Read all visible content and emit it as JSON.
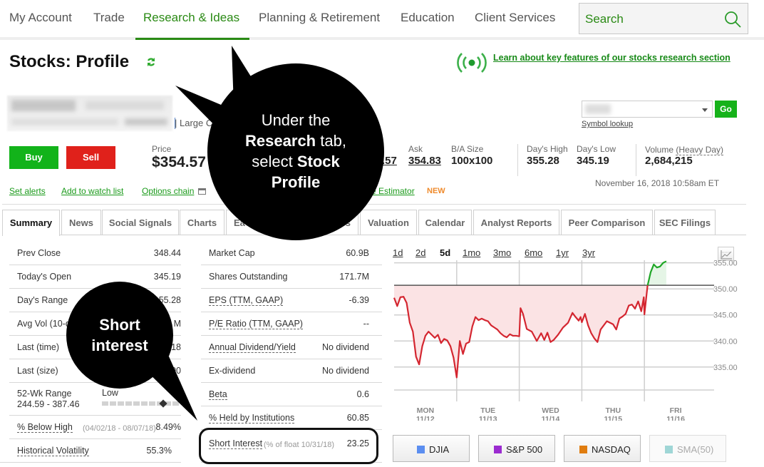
{
  "nav": {
    "items": [
      "My Account",
      "Trade",
      "Research & Ideas",
      "Planning & Retirement",
      "Education",
      "Client Services"
    ],
    "active_index": 2,
    "search_placeholder": "Search",
    "accent_color": "#2a8a14"
  },
  "header": {
    "title": "Stocks: Profile",
    "learn_link": "Learn about key features of our stocks research section"
  },
  "company": {
    "cap_label": "| Large Ca",
    "symbol_lookup": "Symbol lookup",
    "go_label": "Go"
  },
  "quote": {
    "buy_label": "Buy",
    "sell_label": "Sell",
    "price_label": "Price",
    "price": "$354.57",
    "bid_partial": ".57",
    "ask_label": "Ask",
    "ask": "354.83",
    "ba_size_label": "B/A Size",
    "ba_size": "100x100",
    "days_high_label": "Day's High",
    "days_high": "355.28",
    "days_low_label": "Day's Low",
    "days_low": "345.19",
    "volume_label": "Volume",
    "heavy_day_label": "(Heavy Day)",
    "volume": "2,684,215",
    "timestamp": "November 16, 2018 10:58am ET"
  },
  "actions": {
    "set_alerts": "Set alerts",
    "add_watch": "Add to watch list",
    "options_chain": "Options chain",
    "estimator_partial": "e Estimator",
    "new_badge": "NEW"
  },
  "tabs": [
    "Summary",
    "News",
    "Social Signals",
    "Charts",
    "Ea",
    "s",
    "Valuation",
    "Calendar",
    "Analyst Reports",
    "Peer Comparison",
    "SEC Filings"
  ],
  "summary_left": [
    {
      "key": "Prev Close",
      "value": "348.44"
    },
    {
      "key": "Today's Open",
      "value": "345.19"
    },
    {
      "key": "Day's Range",
      "value": "55.28"
    },
    {
      "key": "Avg Vol (10-d",
      "value": "M"
    },
    {
      "key": "Last (time)",
      "value": "18"
    },
    {
      "key": "Last (size)",
      "value": "00"
    },
    {
      "key": "52-Wk Range",
      "key2": "244.59 - 387.46",
      "range_low_label": "Low",
      "range_position": 0.78
    },
    {
      "key": "% Below High",
      "sub": "(04/02/18 - 08/07/18)",
      "value": "8.49%"
    },
    {
      "key": "Historical Volatility",
      "value": "55.3%"
    }
  ],
  "summary_right": [
    {
      "key": "Market Cap",
      "value": "60.9B"
    },
    {
      "key": "Shares Outstanding",
      "value": "171.7M"
    },
    {
      "key": "EPS (TTM, GAAP)",
      "value": "-6.39"
    },
    {
      "key": "P/E Ratio (TTM, GAAP)",
      "value": "--"
    },
    {
      "key": "Annual Dividend/Yield",
      "value": "No dividend"
    },
    {
      "key": "Ex-dividend",
      "value": "No dividend"
    },
    {
      "key": "Beta",
      "value": "0.6"
    },
    {
      "key": "% Held by Institutions",
      "value": "60.85"
    },
    {
      "key": "Short Interest",
      "sub": "(% of float 10/31/18)",
      "value": "23.25"
    }
  ],
  "chart": {
    "ranges": [
      "1d",
      "2d",
      "5d",
      "1mo",
      "3mo",
      "6mo",
      "1yr",
      "3yr"
    ],
    "active_range": "5d",
    "compare_buttons": [
      {
        "label": "DJIA",
        "color": "#5b8ef0",
        "enabled": true
      },
      {
        "label": "S&P 500",
        "color": "#9b2bd0",
        "enabled": true
      },
      {
        "label": "NASDAQ",
        "color": "#e07d10",
        "enabled": true
      },
      {
        "label": "SMA(50)",
        "color": "#9fd6d6",
        "enabled": false
      }
    ]
  },
  "chart_data": {
    "type": "line",
    "title": "",
    "xlabel": "",
    "ylabel": "",
    "x_tick_labels": [
      {
        "day": "MON",
        "date": "11/12"
      },
      {
        "day": "TUE",
        "date": "11/13"
      },
      {
        "day": "WED",
        "date": "11/14"
      },
      {
        "day": "THU",
        "date": "11/15"
      },
      {
        "day": "FRI",
        "date": "11/16"
      }
    ],
    "y_tick_labels": [
      "355.00",
      "350.00",
      "345.00",
      "340.00",
      "335.00"
    ],
    "ylim": [
      329.5,
      355.5
    ],
    "xlim": [
      0,
      5
    ],
    "reference_line": 350.7,
    "grid": true,
    "series": [
      {
        "name": "price",
        "below_color": "#d42630",
        "above_color": "#1fa626",
        "x": [
          0,
          0.05,
          0.1,
          0.15,
          0.2,
          0.25,
          0.3,
          0.35,
          0.4,
          0.45,
          0.5,
          0.55,
          0.6,
          0.65,
          0.7,
          0.75,
          0.8,
          0.85,
          0.9,
          0.95,
          1.0,
          1.05,
          1.1,
          1.15,
          1.2,
          1.25,
          1.3,
          1.35,
          1.4,
          1.45,
          1.5,
          1.55,
          1.6,
          1.65,
          1.7,
          1.75,
          1.8,
          1.85,
          1.9,
          1.95,
          2.0,
          2.02,
          2.06,
          2.12,
          2.2,
          2.28,
          2.35,
          2.4,
          2.45,
          2.5,
          2.55,
          2.62,
          2.7,
          2.78,
          2.85,
          2.9,
          2.95,
          2.98,
          3.0,
          3.05,
          3.1,
          3.15,
          3.2,
          3.25,
          3.3,
          3.4,
          3.5,
          3.55,
          3.6,
          3.65,
          3.7,
          3.75,
          3.8,
          3.85,
          3.9,
          3.95,
          3.99,
          4.0,
          4.05,
          4.1,
          4.15,
          4.2,
          4.25,
          4.3,
          4.35
        ],
        "y": [
          348.3,
          346.7,
          348.4,
          348.5,
          347.3,
          343.5,
          341.8,
          337.0,
          335.5,
          339.0,
          341.0,
          341.8,
          341.2,
          340.6,
          341.2,
          339.6,
          340.4,
          340.1,
          339.0,
          336.8,
          333.0,
          340.0,
          337.5,
          339.5,
          339.8,
          342.8,
          344.6,
          344.0,
          344.3,
          344.0,
          343.8,
          343.0,
          342.6,
          342.2,
          341.5,
          341.0,
          340.7,
          341.3,
          341.0,
          341.0,
          340.9,
          346.3,
          345.2,
          342.3,
          341.8,
          340.0,
          341.5,
          340.2,
          341.6,
          339.8,
          340.2,
          341.2,
          342.6,
          343.5,
          345.4,
          344.6,
          343.9,
          344.6,
          343.6,
          345.2,
          343.0,
          341.5,
          340.5,
          339.8,
          342.2,
          343.8,
          343.2,
          342.2,
          344.3,
          344.7,
          345.2,
          346.8,
          347.0,
          346.2,
          347.6,
          345.7,
          348.4,
          345.1,
          350.6,
          353.2,
          354.7,
          354.1,
          354.3,
          355.0,
          355.3
        ]
      }
    ]
  },
  "callouts": {
    "research": {
      "line1": "Under the",
      "bold1": "Research",
      "line2_rest": " tab,",
      "line3_pre": "select ",
      "bold3": "Stock",
      "bold4": "Profile"
    },
    "short_interest": {
      "line1": "Short",
      "line2": "interest"
    }
  }
}
